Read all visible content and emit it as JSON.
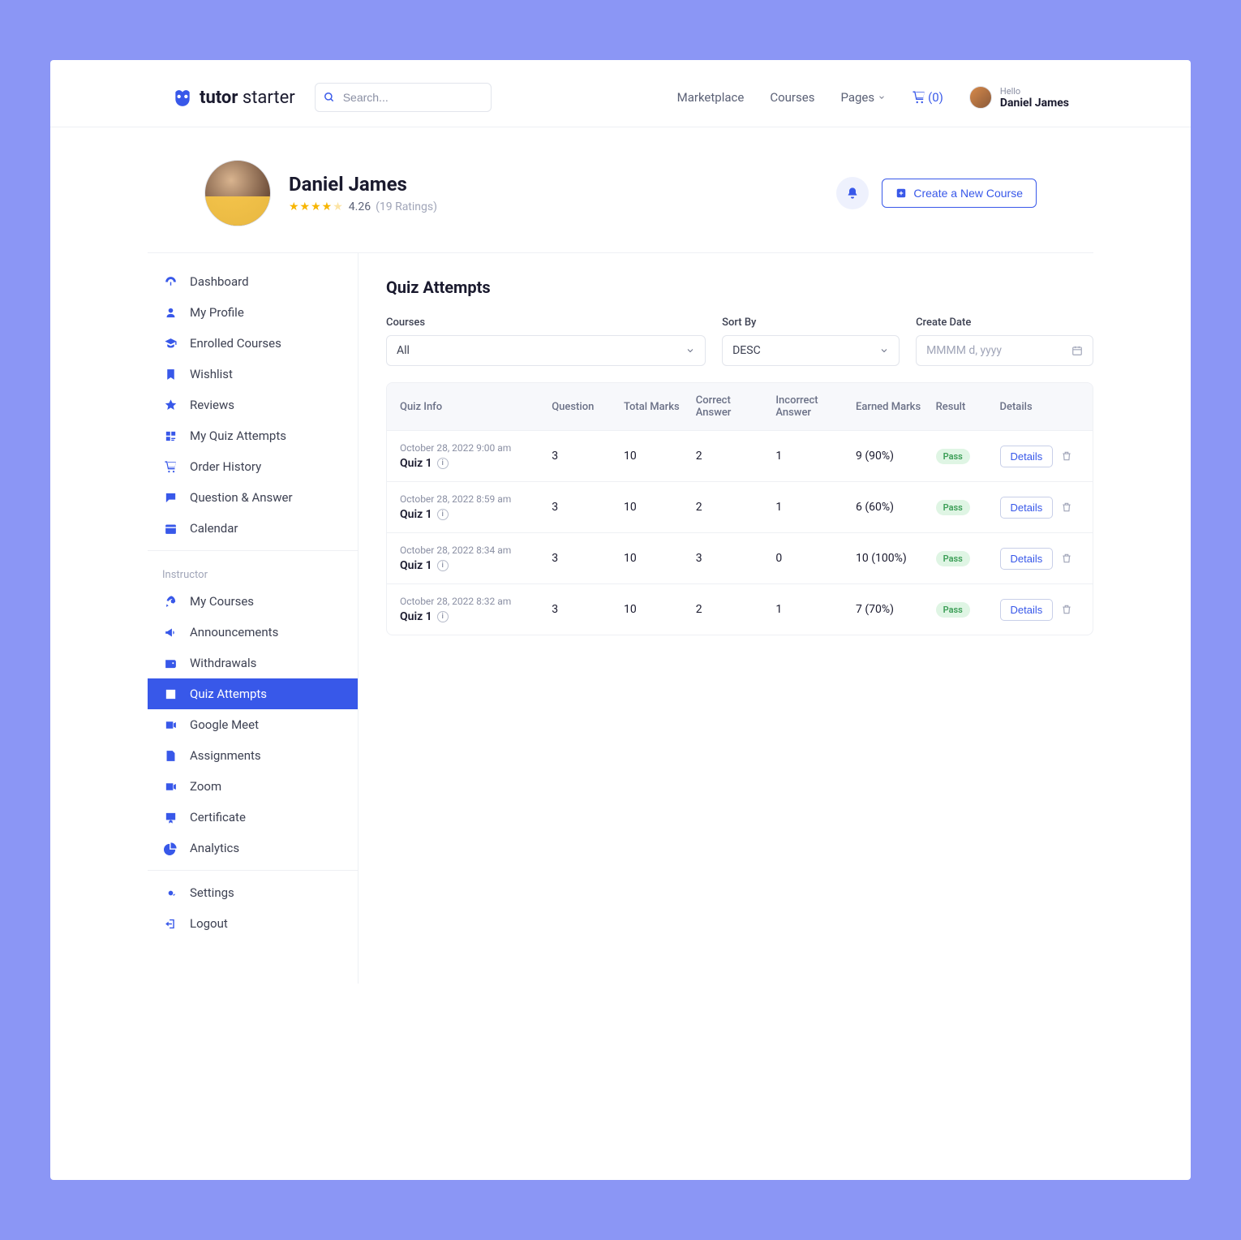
{
  "brand": {
    "name1": "tutor",
    "name2": " starter"
  },
  "search": {
    "placeholder": "Search..."
  },
  "nav": {
    "marketplace": "Marketplace",
    "courses": "Courses",
    "pages": "Pages",
    "cart_count": "(0)"
  },
  "user": {
    "hello": "Hello",
    "name": "Daniel James"
  },
  "profile": {
    "name": "Daniel James",
    "rating_value": "4.26",
    "rating_count": "(19 Ratings)",
    "create_course": "Create a New Course"
  },
  "sidebar": {
    "student": [
      {
        "icon": "dashboard",
        "label": "Dashboard"
      },
      {
        "icon": "user",
        "label": "My Profile"
      },
      {
        "icon": "cap",
        "label": "Enrolled Courses"
      },
      {
        "icon": "bookmark",
        "label": "Wishlist"
      },
      {
        "icon": "star",
        "label": "Reviews"
      },
      {
        "icon": "quiz",
        "label": "My Quiz Attempts"
      },
      {
        "icon": "cart",
        "label": "Order History"
      },
      {
        "icon": "qa",
        "label": "Question & Answer"
      },
      {
        "icon": "calendar",
        "label": "Calendar"
      }
    ],
    "instructor_label": "Instructor",
    "instructor": [
      {
        "icon": "rocket",
        "label": "My Courses"
      },
      {
        "icon": "horn",
        "label": "Announcements"
      },
      {
        "icon": "wallet",
        "label": "Withdrawals"
      },
      {
        "icon": "quiz2",
        "label": "Quiz Attempts",
        "active": true
      },
      {
        "icon": "gmeet",
        "label": "Google Meet"
      },
      {
        "icon": "assign",
        "label": "Assignments"
      },
      {
        "icon": "zoom",
        "label": "Zoom"
      },
      {
        "icon": "cert",
        "label": "Certificate"
      },
      {
        "icon": "pie",
        "label": "Analytics"
      }
    ],
    "footer": [
      {
        "icon": "gear",
        "label": "Settings"
      },
      {
        "icon": "logout",
        "label": "Logout"
      }
    ]
  },
  "page": {
    "title": "Quiz Attempts",
    "filters": {
      "courses_label": "Courses",
      "courses_value": "All",
      "sort_label": "Sort By",
      "sort_value": "DESC",
      "date_label": "Create Date",
      "date_placeholder": "MMMM d, yyyy"
    },
    "columns": {
      "quiz_info": "Quiz Info",
      "question": "Question",
      "total_marks": "Total Marks",
      "correct": "Correct Answer",
      "incorrect": "Incorrect Answer",
      "earned": "Earned Marks",
      "result": "Result",
      "details": "Details"
    },
    "rows": [
      {
        "date": "October 28, 2022 9:00 am",
        "name": "Quiz 1",
        "question": "3",
        "total": "10",
        "correct": "2",
        "incorrect": "1",
        "earned": "9 (90%)",
        "result": "Pass",
        "details": "Details"
      },
      {
        "date": "October 28, 2022 8:59 am",
        "name": "Quiz 1",
        "question": "3",
        "total": "10",
        "correct": "2",
        "incorrect": "1",
        "earned": "6 (60%)",
        "result": "Pass",
        "details": "Details"
      },
      {
        "date": "October 28, 2022 8:34 am",
        "name": "Quiz 1",
        "question": "3",
        "total": "10",
        "correct": "3",
        "incorrect": "0",
        "earned": "10 (100%)",
        "result": "Pass",
        "details": "Details"
      },
      {
        "date": "October 28, 2022 8:32 am",
        "name": "Quiz 1",
        "question": "3",
        "total": "10",
        "correct": "2",
        "incorrect": "1",
        "earned": "7 (70%)",
        "result": "Pass",
        "details": "Details"
      }
    ]
  }
}
